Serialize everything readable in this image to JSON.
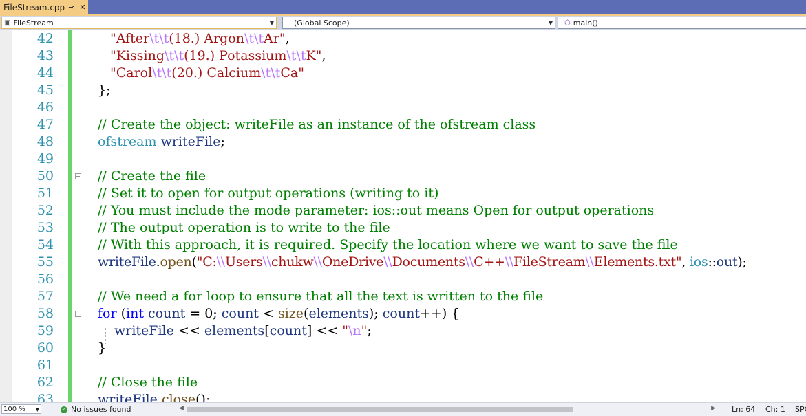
{
  "tab": {
    "title": "FileStream.cpp",
    "pin": "⊸",
    "close": "✕"
  },
  "nav": {
    "project": "FileStream",
    "scope": "(Global Scope)",
    "member": "main()"
  },
  "line_numbers": [
    "42",
    "43",
    "44",
    "45",
    "46",
    "47",
    "48",
    "49",
    "50",
    "51",
    "52",
    "53",
    "54",
    "55",
    "56",
    "57",
    "58",
    "59",
    "60",
    "61",
    "62",
    "63"
  ],
  "code": {
    "l42": {
      "q1": "\"After",
      "e1": "\\t\\t",
      "t1": "(18.) Argon",
      "e2": "\\t\\t",
      "t2": "Ar\"",
      "p": ","
    },
    "l43": {
      "q1": "\"Kissing",
      "e1": "\\t\\t",
      "t1": "(19.) Potassium",
      "e2": "\\t\\t",
      "t2": "K\"",
      "p": ","
    },
    "l44": {
      "q1": "\"Carol",
      "e1": "\\t\\t",
      "t1": "(20.) Calcium",
      "e2": "\\t\\t",
      "t2": "Ca\""
    },
    "l45": "};",
    "l47": "// Create the object: writeFile as an instance of the ofstream class",
    "l48": {
      "type": "ofstream",
      "var": "writeFile",
      "end": ";"
    },
    "l50": "// Create the file",
    "l51": "// Set it to open for output operations (writing to it)",
    "l52": "// You must include the mode parameter: ios::out means Open for output operations",
    "l53": "// The output operation is to write to the file",
    "l54": "// With this approach, it is required. Specify the location where we want to save the file",
    "l55": {
      "var": "writeFile",
      "dot": ".",
      "fn": "open",
      "paren": "(",
      "s1": "\"C:",
      "e1": "\\\\",
      "s2": "Users",
      "e2": "\\\\",
      "s3": "chukw",
      "e3": "\\\\",
      "s4": "OneDrive",
      "e4": "\\\\",
      "s5": "Documents",
      "e5": "\\\\",
      "s6": "C++",
      "e6": "\\\\",
      "s7": "FileStream",
      "e7": "\\\\",
      "s8": "Elements.txt\"",
      "comma": ", ",
      "ns": "ios",
      "scope": "::",
      "member": "out",
      "end": ");"
    },
    "l57": "// We need a for loop to ensure that all the text is written to the file",
    "l58": {
      "kw": "for",
      "p1": " (",
      "kw2": "int",
      "sp": " ",
      "v1": "count",
      "t1": " = 0; ",
      "v2": "count",
      "t2": " < ",
      "fn": "size",
      "p2": "(",
      "v3": "elements",
      "t3": "); ",
      "v4": "count",
      "t4": "++) {"
    },
    "l59": {
      "v1": "writeFile",
      "t1": " << ",
      "v2": "elements",
      "t2": "[",
      "v3": "count",
      "t3": "] << ",
      "s1": "\"",
      "e1": "\\n",
      "s2": "\"",
      "end": ";"
    },
    "l60": "}",
    "l62": "// Close the file",
    "l63": {
      "var": "writeFile",
      "dot": ".",
      "fn": "close",
      "end": "();"
    }
  },
  "status": {
    "zoom": "100 %",
    "issues": "No issues found",
    "line": "Ln: 64",
    "char": "Ch: 1",
    "spc": "SPC"
  },
  "colors": {
    "comment": "#008000",
    "string": "#a31515",
    "escape": "#b776fb",
    "keyword": "#0000ff",
    "type": "#2b91af",
    "variable": "#1f377f",
    "function": "#74531f",
    "line_number": "#2b91af",
    "tab_active": "#f5cc84",
    "tabstrip": "#5c6cb5",
    "change_bar": "#6bd46b"
  },
  "icons": {
    "project": "class-view-icon",
    "member": "cube-method-icon",
    "issues": "check-circle-icon"
  }
}
